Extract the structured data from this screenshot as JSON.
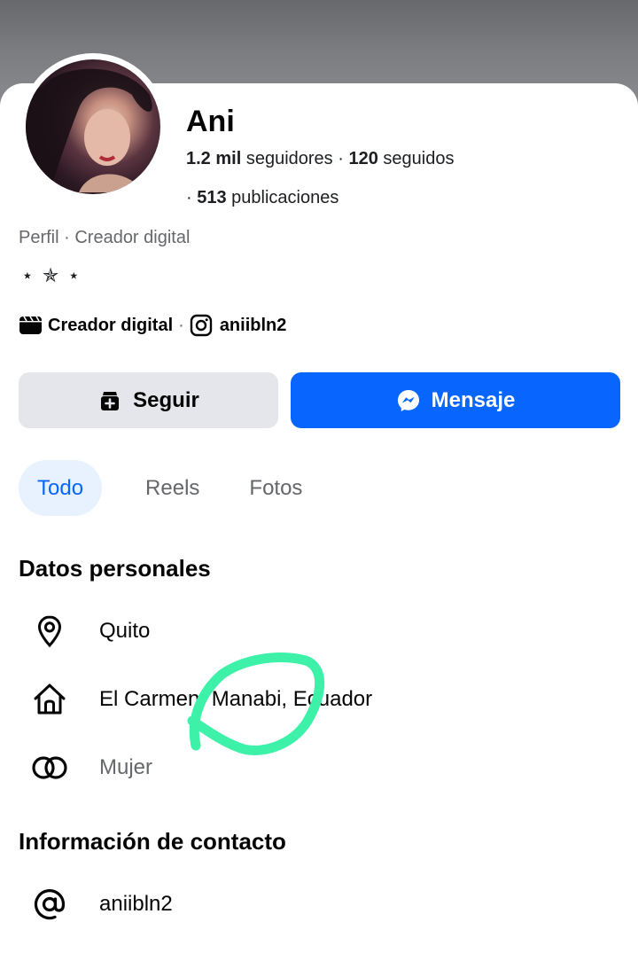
{
  "profile": {
    "name": "Ani",
    "followers_count": "1.2 mil",
    "followers_label": "seguidores",
    "following_count": "120",
    "following_label": "seguidos",
    "posts_count": "513",
    "posts_label": "publicaciones",
    "category_line": "Perfil · Creador digital",
    "bio": "⋆ ✯ ⋆",
    "creator_label": "Creador digital",
    "instagram_handle": "aniibln2"
  },
  "actions": {
    "follow_label": "Seguir",
    "message_label": "Mensaje"
  },
  "tabs": [
    {
      "label": "Todo",
      "active": true
    },
    {
      "label": "Reels",
      "active": false
    },
    {
      "label": "Fotos",
      "active": false
    }
  ],
  "personal_details": {
    "title": "Datos personales",
    "items": [
      {
        "icon": "location-pin-icon",
        "text": "Quito"
      },
      {
        "icon": "home-icon",
        "text": "El Carmen, Manabi, Ecuador"
      },
      {
        "icon": "relationship-rings-icon",
        "text": "Mujer"
      }
    ]
  },
  "contact_info": {
    "title": "Información de contacto",
    "items": [
      {
        "icon": "at-sign-icon",
        "text": "aniibln2"
      }
    ]
  },
  "colors": {
    "primary_blue": "#0866ff",
    "annotation_green": "#3df2a8",
    "secondary_button": "#e4e6eb"
  }
}
